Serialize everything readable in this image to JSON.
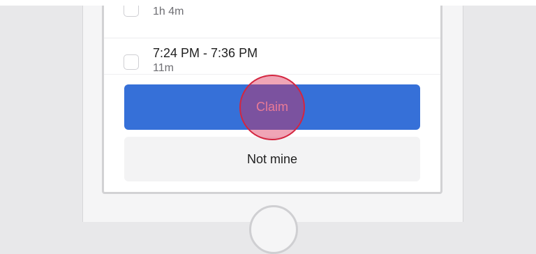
{
  "list": {
    "items": [
      {
        "time": "",
        "duration": "1h 4m"
      },
      {
        "time": "7:24 PM - 7:36 PM",
        "duration": "11m"
      }
    ]
  },
  "actions": {
    "claim_label": "Claim",
    "not_mine_label": "Not mine"
  },
  "colors": {
    "primary": "#3670d8",
    "secondary_bg": "#f3f3f4",
    "tap_indicator": "#d4253f"
  }
}
